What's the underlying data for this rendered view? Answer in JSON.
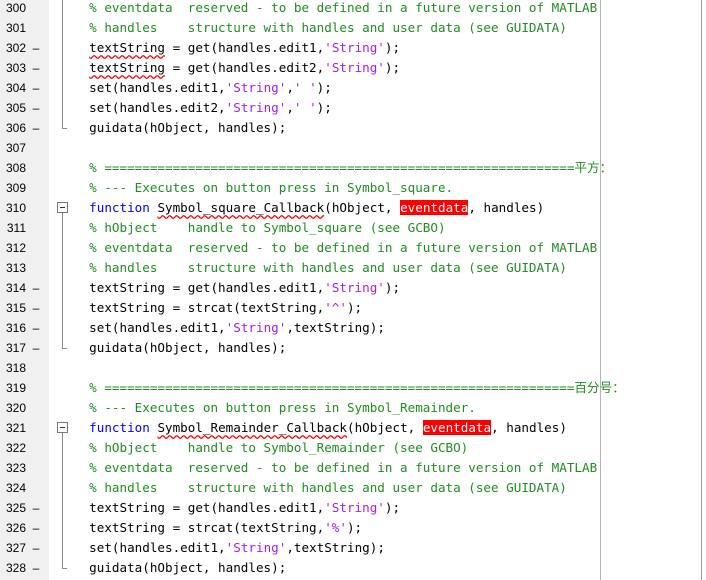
{
  "colors": {
    "keyword": "#0000ff",
    "string": "#a020f0",
    "comment": "#228b22",
    "highlight_bg": "#ff0000",
    "highlight_fg": "#ffffff",
    "squiggle": "#ff0000",
    "gutter_bg": "#f0f0f0"
  },
  "lines": [
    {
      "n": "300",
      "mark": "",
      "fold": "line",
      "segments": [
        {
          "t": "  % eventdata  reserved - to be defined in a future version of MATLAB",
          "c": "cm"
        }
      ]
    },
    {
      "n": "301",
      "mark": "",
      "fold": "line",
      "segments": [
        {
          "t": "  % handles    structure with handles and user data (see GUIDATA)",
          "c": "cm"
        }
      ]
    },
    {
      "n": "302",
      "mark": "–",
      "fold": "line",
      "segments": [
        {
          "t": "  ",
          "c": "plain"
        },
        {
          "t": "textString",
          "c": "sq"
        },
        {
          "t": " = get(handles.edit1,",
          "c": "plain"
        },
        {
          "t": "'String'",
          "c": "str"
        },
        {
          "t": ");",
          "c": "plain"
        }
      ]
    },
    {
      "n": "303",
      "mark": "–",
      "fold": "line",
      "segments": [
        {
          "t": "  ",
          "c": "plain"
        },
        {
          "t": "textString",
          "c": "sq"
        },
        {
          "t": " = get(handles.edit2,",
          "c": "plain"
        },
        {
          "t": "'String'",
          "c": "str"
        },
        {
          "t": ");",
          "c": "plain"
        }
      ]
    },
    {
      "n": "304",
      "mark": "–",
      "fold": "line",
      "segments": [
        {
          "t": "  set(handles.edit1,",
          "c": "plain"
        },
        {
          "t": "'String'",
          "c": "str"
        },
        {
          "t": ",",
          "c": "plain"
        },
        {
          "t": "' '",
          "c": "str"
        },
        {
          "t": ");",
          "c": "plain"
        }
      ]
    },
    {
      "n": "305",
      "mark": "–",
      "fold": "line",
      "segments": [
        {
          "t": "  set(handles.edit2,",
          "c": "plain"
        },
        {
          "t": "'String'",
          "c": "str"
        },
        {
          "t": ",",
          "c": "plain"
        },
        {
          "t": "' '",
          "c": "str"
        },
        {
          "t": ");",
          "c": "plain"
        }
      ]
    },
    {
      "n": "306",
      "mark": "–",
      "fold": "end",
      "segments": [
        {
          "t": "  guidata(hObject, handles);",
          "c": "plain"
        }
      ]
    },
    {
      "n": "307",
      "mark": "",
      "fold": "",
      "segments": []
    },
    {
      "n": "308",
      "mark": "",
      "fold": "",
      "segments": [
        {
          "t": "  % ==============================================================平方：",
          "c": "cm"
        }
      ]
    },
    {
      "n": "309",
      "mark": "",
      "fold": "",
      "segments": [
        {
          "t": "  % --- Executes on button press in Symbol_square.",
          "c": "cm"
        }
      ]
    },
    {
      "n": "310",
      "mark": "",
      "fold": "box",
      "segments": [
        {
          "t": "  ",
          "c": "plain"
        },
        {
          "t": "function",
          "c": "kw"
        },
        {
          "t": " ",
          "c": "plain"
        },
        {
          "t": "Symbol_square_Callback",
          "c": "sq"
        },
        {
          "t": "(hObject, ",
          "c": "plain"
        },
        {
          "t": "eventdata",
          "c": "hl"
        },
        {
          "t": ", handles)",
          "c": "plain"
        }
      ]
    },
    {
      "n": "311",
      "mark": "",
      "fold": "line",
      "segments": [
        {
          "t": "  % hObject    handle to Symbol_square (see GCBO)",
          "c": "cm"
        }
      ]
    },
    {
      "n": "312",
      "mark": "",
      "fold": "line",
      "segments": [
        {
          "t": "  % eventdata  reserved - to be defined in a future version of MATLAB",
          "c": "cm"
        }
      ]
    },
    {
      "n": "313",
      "mark": "",
      "fold": "line",
      "segments": [
        {
          "t": "  % handles    structure with handles and user data (see GUIDATA)",
          "c": "cm"
        }
      ]
    },
    {
      "n": "314",
      "mark": "–",
      "fold": "line",
      "segments": [
        {
          "t": "  textString = get(handles.edit1,",
          "c": "plain"
        },
        {
          "t": "'String'",
          "c": "str"
        },
        {
          "t": ");",
          "c": "plain"
        }
      ]
    },
    {
      "n": "315",
      "mark": "–",
      "fold": "line",
      "segments": [
        {
          "t": "  textString = strcat(textString,",
          "c": "plain"
        },
        {
          "t": "'^'",
          "c": "str"
        },
        {
          "t": ");",
          "c": "plain"
        }
      ]
    },
    {
      "n": "316",
      "mark": "–",
      "fold": "line",
      "segments": [
        {
          "t": "  set(handles.edit1,",
          "c": "plain"
        },
        {
          "t": "'String'",
          "c": "str"
        },
        {
          "t": ",textString);",
          "c": "plain"
        }
      ]
    },
    {
      "n": "317",
      "mark": "–",
      "fold": "end",
      "segments": [
        {
          "t": "  guidata(hObject, handles);",
          "c": "plain"
        }
      ]
    },
    {
      "n": "318",
      "mark": "",
      "fold": "",
      "segments": []
    },
    {
      "n": "319",
      "mark": "",
      "fold": "",
      "segments": [
        {
          "t": "  % ==============================================================百分号：",
          "c": "cm"
        }
      ]
    },
    {
      "n": "320",
      "mark": "",
      "fold": "",
      "segments": [
        {
          "t": "  % --- Executes on button press in Symbol_Remainder.",
          "c": "cm"
        }
      ]
    },
    {
      "n": "321",
      "mark": "",
      "fold": "box",
      "segments": [
        {
          "t": "  ",
          "c": "plain"
        },
        {
          "t": "function",
          "c": "kw"
        },
        {
          "t": " ",
          "c": "plain"
        },
        {
          "t": "Symbol_Remainder_Callback",
          "c": "sq"
        },
        {
          "t": "(hObject, ",
          "c": "plain"
        },
        {
          "t": "eventdata",
          "c": "hl"
        },
        {
          "t": ", handles)",
          "c": "plain"
        }
      ]
    },
    {
      "n": "322",
      "mark": "",
      "fold": "line",
      "segments": [
        {
          "t": "  % hObject    handle to Symbol_Remainder (see GCBO)",
          "c": "cm"
        }
      ]
    },
    {
      "n": "323",
      "mark": "",
      "fold": "line",
      "segments": [
        {
          "t": "  % eventdata  reserved - to be defined in a future version of MATLAB",
          "c": "cm"
        }
      ]
    },
    {
      "n": "324",
      "mark": "",
      "fold": "line",
      "segments": [
        {
          "t": "  % handles    structure with handles and user data (see GUIDATA)",
          "c": "cm"
        }
      ]
    },
    {
      "n": "325",
      "mark": "–",
      "fold": "line",
      "segments": [
        {
          "t": "  textString = get(handles.edit1,",
          "c": "plain"
        },
        {
          "t": "'String'",
          "c": "str"
        },
        {
          "t": ");",
          "c": "plain"
        }
      ]
    },
    {
      "n": "326",
      "mark": "–",
      "fold": "line",
      "segments": [
        {
          "t": "  textString = strcat(textString,",
          "c": "plain"
        },
        {
          "t": "'%'",
          "c": "str"
        },
        {
          "t": ");",
          "c": "plain"
        }
      ]
    },
    {
      "n": "327",
      "mark": "–",
      "fold": "line",
      "segments": [
        {
          "t": "  set(handles.edit1,",
          "c": "plain"
        },
        {
          "t": "'String'",
          "c": "str"
        },
        {
          "t": ",textString);",
          "c": "plain"
        }
      ]
    },
    {
      "n": "328",
      "mark": "–",
      "fold": "end",
      "segments": [
        {
          "t": "  guidata(hObject, handles);",
          "c": "plain"
        }
      ]
    }
  ]
}
